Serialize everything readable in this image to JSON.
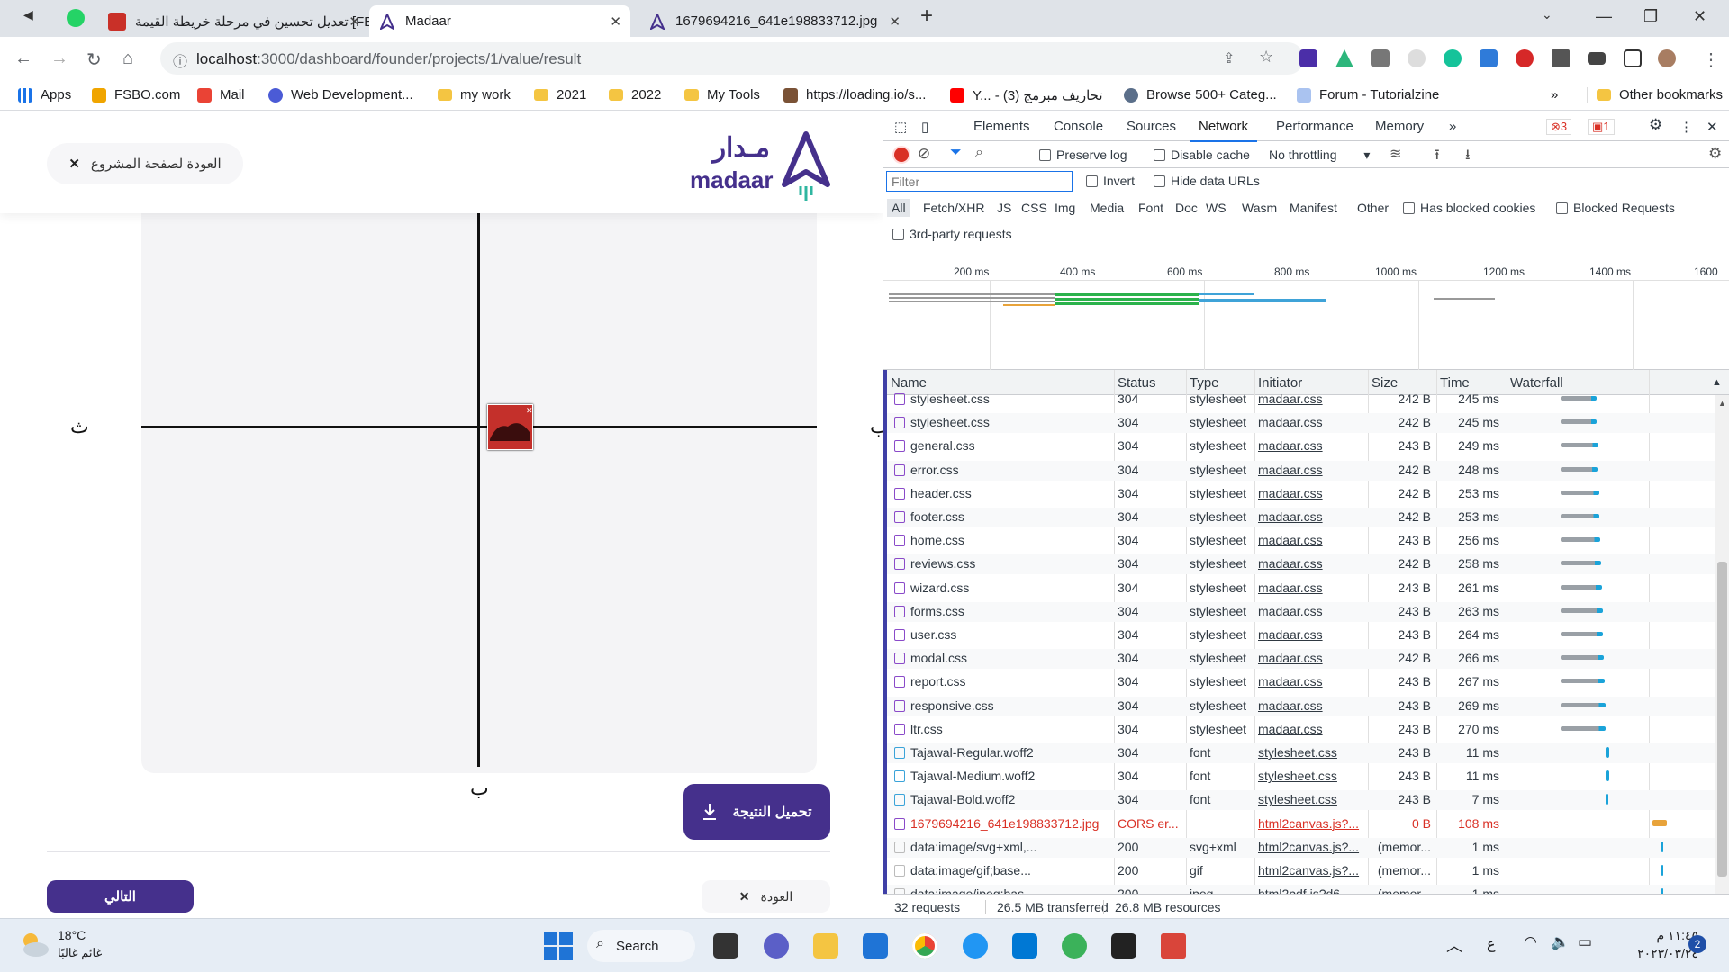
{
  "browser": {
    "tabs": [
      {
        "title": "[FE] تعديل تحسين في مرحلة خريطة القيمة"
      },
      {
        "title": "Madaar"
      },
      {
        "title": "1679694216_641e198833712.jpg"
      }
    ],
    "url_host": "localhost",
    "url_path": ":3000/dashboard/founder/projects/1/value/result",
    "bookmarks": [
      "Apps",
      "FSBO.com",
      "Mail",
      "Web Development...",
      "my work",
      "2021",
      "2022",
      "My Tools",
      "https://loading.io/s...",
      "Y... - تحاريف مبرمج (3)",
      "Browse 500+ Categ...",
      "Forum - Tutorialzine"
    ],
    "other_bookmarks": "Other bookmarks"
  },
  "page": {
    "back_to_project": "العودة لصفحة المشروع",
    "logo_arabic": "مـدار",
    "logo_latin": "madaar",
    "quadrant_labels": {
      "left": "ث",
      "right": "ب",
      "bottom": "ب"
    },
    "download_result": "تحميل النتيجة",
    "next": "التالي",
    "back": "العودة"
  },
  "devtools": {
    "tabs": [
      "Elements",
      "Console",
      "Sources",
      "Network",
      "Performance",
      "Memory"
    ],
    "errors": "3",
    "warnings": "1",
    "toolbar": {
      "preserve_log": "Preserve log",
      "disable_cache": "Disable cache",
      "throttling": "No throttling"
    },
    "filter_placeholder": "Filter",
    "invert": "Invert",
    "hide_data_urls": "Hide data URLs",
    "type_filters": [
      "All",
      "Fetch/XHR",
      "JS",
      "CSS",
      "Img",
      "Media",
      "Font",
      "Doc",
      "WS",
      "Wasm",
      "Manifest",
      "Other"
    ],
    "has_blocked_cookies": "Has blocked cookies",
    "blocked_requests": "Blocked Requests",
    "third_party": "3rd-party requests",
    "ruler": [
      "200 ms",
      "400 ms",
      "600 ms",
      "800 ms",
      "1000 ms",
      "1200 ms",
      "1400 ms",
      "1600"
    ],
    "columns": [
      "Name",
      "Status",
      "Type",
      "Initiator",
      "Size",
      "Time",
      "Waterfall"
    ],
    "rows": [
      {
        "name": "stylesheet.css",
        "status": "304",
        "type": "stylesheet",
        "initiator": "madaar.css",
        "size": "242 B",
        "time": "245 ms",
        "kind": "css"
      },
      {
        "name": "stylesheet.css",
        "status": "304",
        "type": "stylesheet",
        "initiator": "madaar.css",
        "size": "242 B",
        "time": "245 ms",
        "kind": "css"
      },
      {
        "name": "general.css",
        "status": "304",
        "type": "stylesheet",
        "initiator": "madaar.css",
        "size": "243 B",
        "time": "249 ms",
        "kind": "css"
      },
      {
        "name": "error.css",
        "status": "304",
        "type": "stylesheet",
        "initiator": "madaar.css",
        "size": "242 B",
        "time": "248 ms",
        "kind": "css"
      },
      {
        "name": "header.css",
        "status": "304",
        "type": "stylesheet",
        "initiator": "madaar.css",
        "size": "242 B",
        "time": "253 ms",
        "kind": "css"
      },
      {
        "name": "footer.css",
        "status": "304",
        "type": "stylesheet",
        "initiator": "madaar.css",
        "size": "242 B",
        "time": "253 ms",
        "kind": "css"
      },
      {
        "name": "home.css",
        "status": "304",
        "type": "stylesheet",
        "initiator": "madaar.css",
        "size": "243 B",
        "time": "256 ms",
        "kind": "css"
      },
      {
        "name": "reviews.css",
        "status": "304",
        "type": "stylesheet",
        "initiator": "madaar.css",
        "size": "242 B",
        "time": "258 ms",
        "kind": "css"
      },
      {
        "name": "wizard.css",
        "status": "304",
        "type": "stylesheet",
        "initiator": "madaar.css",
        "size": "243 B",
        "time": "261 ms",
        "kind": "css"
      },
      {
        "name": "forms.css",
        "status": "304",
        "type": "stylesheet",
        "initiator": "madaar.css",
        "size": "243 B",
        "time": "263 ms",
        "kind": "css"
      },
      {
        "name": "user.css",
        "status": "304",
        "type": "stylesheet",
        "initiator": "madaar.css",
        "size": "243 B",
        "time": "264 ms",
        "kind": "css"
      },
      {
        "name": "modal.css",
        "status": "304",
        "type": "stylesheet",
        "initiator": "madaar.css",
        "size": "242 B",
        "time": "266 ms",
        "kind": "css"
      },
      {
        "name": "report.css",
        "status": "304",
        "type": "stylesheet",
        "initiator": "madaar.css",
        "size": "243 B",
        "time": "267 ms",
        "kind": "css"
      },
      {
        "name": "responsive.css",
        "status": "304",
        "type": "stylesheet",
        "initiator": "madaar.css",
        "size": "243 B",
        "time": "269 ms",
        "kind": "css"
      },
      {
        "name": "ltr.css",
        "status": "304",
        "type": "stylesheet",
        "initiator": "madaar.css",
        "size": "243 B",
        "time": "270 ms",
        "kind": "css"
      },
      {
        "name": "Tajawal-Regular.woff2",
        "status": "304",
        "type": "font",
        "initiator": "stylesheet.css",
        "size": "243 B",
        "time": "11 ms",
        "kind": "font"
      },
      {
        "name": "Tajawal-Medium.woff2",
        "status": "304",
        "type": "font",
        "initiator": "stylesheet.css",
        "size": "243 B",
        "time": "11 ms",
        "kind": "font"
      },
      {
        "name": "Tajawal-Bold.woff2",
        "status": "304",
        "type": "font",
        "initiator": "stylesheet.css",
        "size": "243 B",
        "time": "7 ms",
        "kind": "font"
      },
      {
        "name": "1679694216_641e198833712.jpg",
        "status": "CORS er...",
        "type": "",
        "initiator": "html2canvas.js?...",
        "size": "0 B",
        "time": "108 ms",
        "kind": "err"
      },
      {
        "name": "data:image/svg+xml,...",
        "status": "200",
        "type": "svg+xml",
        "initiator": "html2canvas.js?...",
        "size": "(memor...",
        "time": "1 ms",
        "kind": "img"
      },
      {
        "name": "data:image/gif;base...",
        "status": "200",
        "type": "gif",
        "initiator": "html2canvas.js?...",
        "size": "(memor...",
        "time": "1 ms",
        "kind": "img"
      },
      {
        "name": "data:image/jpeg;bas...",
        "status": "200",
        "type": "jpeg",
        "initiator": "html2pdf.js?d6...",
        "size": "(memor...",
        "time": "1 ms",
        "kind": "img"
      }
    ],
    "summary": {
      "requests": "32 requests",
      "transferred": "26.5 MB transferred",
      "resources": "26.8 MB resources"
    }
  },
  "taskbar": {
    "weather_temp": "18°C",
    "weather_desc": "غائم غالبًا",
    "search": "Search",
    "time": "١١:٤٥ م",
    "date": "٢٠٢٣/٠٣/٢٤",
    "notifications": "2"
  }
}
